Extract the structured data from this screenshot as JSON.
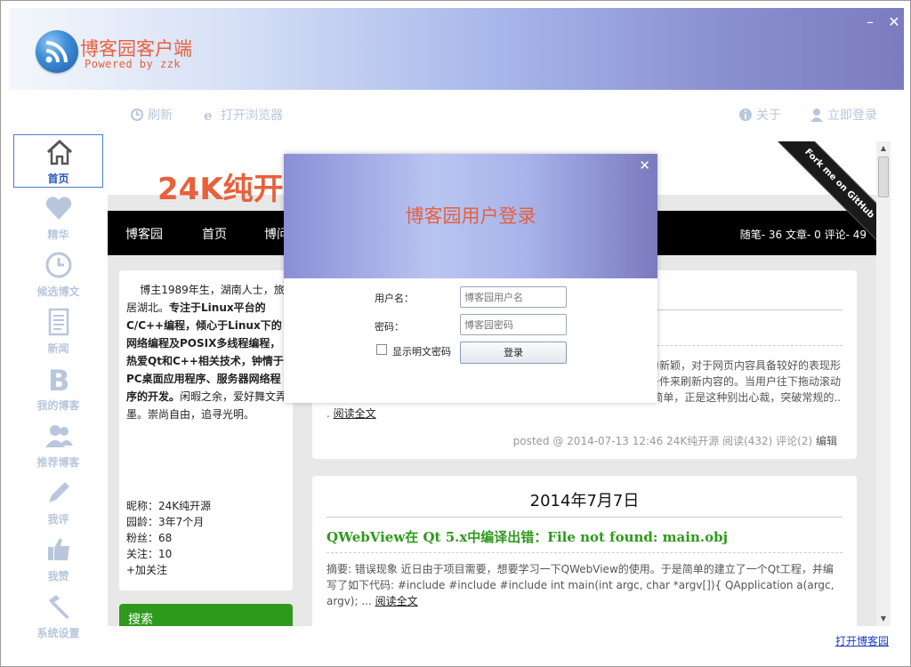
{
  "app": {
    "title": "博客园客户端",
    "subtitle": "Powered by zzk",
    "minimize_glyph": "–",
    "close_glyph": "✕"
  },
  "toolbar": {
    "refresh": "刷新",
    "open_browser": "打开浏览器",
    "about": "关于",
    "login": "立即登录"
  },
  "sidebar": {
    "items": [
      {
        "label": "首页",
        "icon": "home-icon"
      },
      {
        "label": "精华",
        "icon": "heart-icon"
      },
      {
        "label": "候选博文",
        "icon": "clock-icon"
      },
      {
        "label": "新闻",
        "icon": "document-icon"
      },
      {
        "label": "我的博客",
        "icon": "b-letter-icon"
      },
      {
        "label": "推荐博客",
        "icon": "users-icon"
      },
      {
        "label": "我评",
        "icon": "pencil-icon"
      },
      {
        "label": "我赞",
        "icon": "thumbs-up-icon"
      },
      {
        "label": "系统设置",
        "icon": "tools-icon"
      }
    ]
  },
  "blog": {
    "title": "24K纯开",
    "nav": [
      "博客园",
      "首页",
      "博问"
    ],
    "stats": "随笔- 36  文章- 0  评论- 49",
    "ribbon": "Fork me on GitHub"
  },
  "profile": {
    "bio_intro": "博主1989年生，湖南人士，旅居湖北。",
    "bio_bold": "专注于Linux平台的C/C++编程，倾心于Linux下的网络编程及POSIX多线程编程，热爱Qt和C++相关技术，钟情于PC桌面应用程序、服务器网络程序的开发。",
    "bio_end": "闲暇之余，爱好舞文弄墨。崇尚自由，追寻光明。",
    "nickname": "昵称：24K纯开源",
    "age": "园龄：3年7个月",
    "fans": "粉丝：68",
    "following": "关注：10",
    "follow": "+加关注",
    "search": "搜索"
  },
  "posts": [
    {
      "abstract_right_1": "为新颖，对于网页内容具备较好的表现形",
      "abstract_right_2": "条件来刷新内容的。当用户往下拖动滚动",
      "abstract_right_3": "简单，正是这种别出心裁，突破常规的..",
      "read_more": "阅读全文",
      "read_prefix": ". ",
      "footer": "posted @ 2014-07-13 12:46 24K纯开源 阅读(432) 评论(2)",
      "edit": "编辑"
    },
    {
      "date": "2014年7月7日",
      "title": "QWebView在 Qt 5.x中编译出错：File not found: main.obj",
      "abstract": "摘要: 错误现象 近日由于项目需要，想要学习一下QWebView的使用。于是简单的建立了一个Qt工程，并编写了如下代码: #include #include #include int main(int argc, char *argv[]){ QApplication a(argc, argv); ...",
      "read_more": "阅读全文"
    }
  ],
  "footer_link": "打开博客园",
  "login_dialog": {
    "title": "博客园用户登录",
    "close": "✕",
    "username_label": "用户名：",
    "username_placeholder": "博客园用户名",
    "password_label": "密码：",
    "password_placeholder": "博客园密码",
    "show_password": "显示明文密码",
    "submit": "登录"
  },
  "colors": {
    "accent": "#e8603c",
    "sidebar_active": "#2a55b8",
    "sidebar_inactive": "#b8c7dd",
    "post_title": "#2e9a1c"
  }
}
